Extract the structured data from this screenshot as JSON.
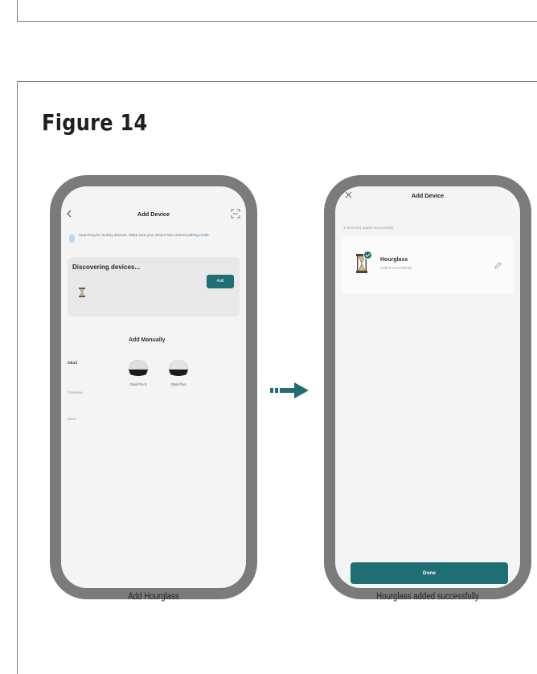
{
  "figure": {
    "title": "Figure 14"
  },
  "left_screen": {
    "title": "Add Device",
    "back_icon": "chevron-left-icon",
    "scan_icon": "scan-icon",
    "banner": {
      "text": "Searching for nearby devices. Make sure your device has entered",
      "link": "pairing mode."
    },
    "discovering": {
      "heading": "Discovering devices...",
      "add_label": "Add"
    },
    "manual": {
      "heading": "Add Manually",
      "categories": [
        "Okuli",
        "Gateway",
        "More"
      ],
      "products": [
        "Okuli Pro S",
        "Okuli Plus"
      ]
    },
    "caption": "Add Hourglass"
  },
  "right_screen": {
    "title": "Add Device",
    "close_icon": "close-icon",
    "status": "1 device(s) added successfully",
    "device": {
      "name": "Hourglass",
      "status": "Added successfully",
      "edit_icon": "pencil-icon"
    },
    "done_label": "Done",
    "caption": "Hourglass added successfully"
  },
  "colors": {
    "accent": "#1e6e73",
    "frame": "#7b7b7b",
    "screen": "#f4f4f4"
  }
}
